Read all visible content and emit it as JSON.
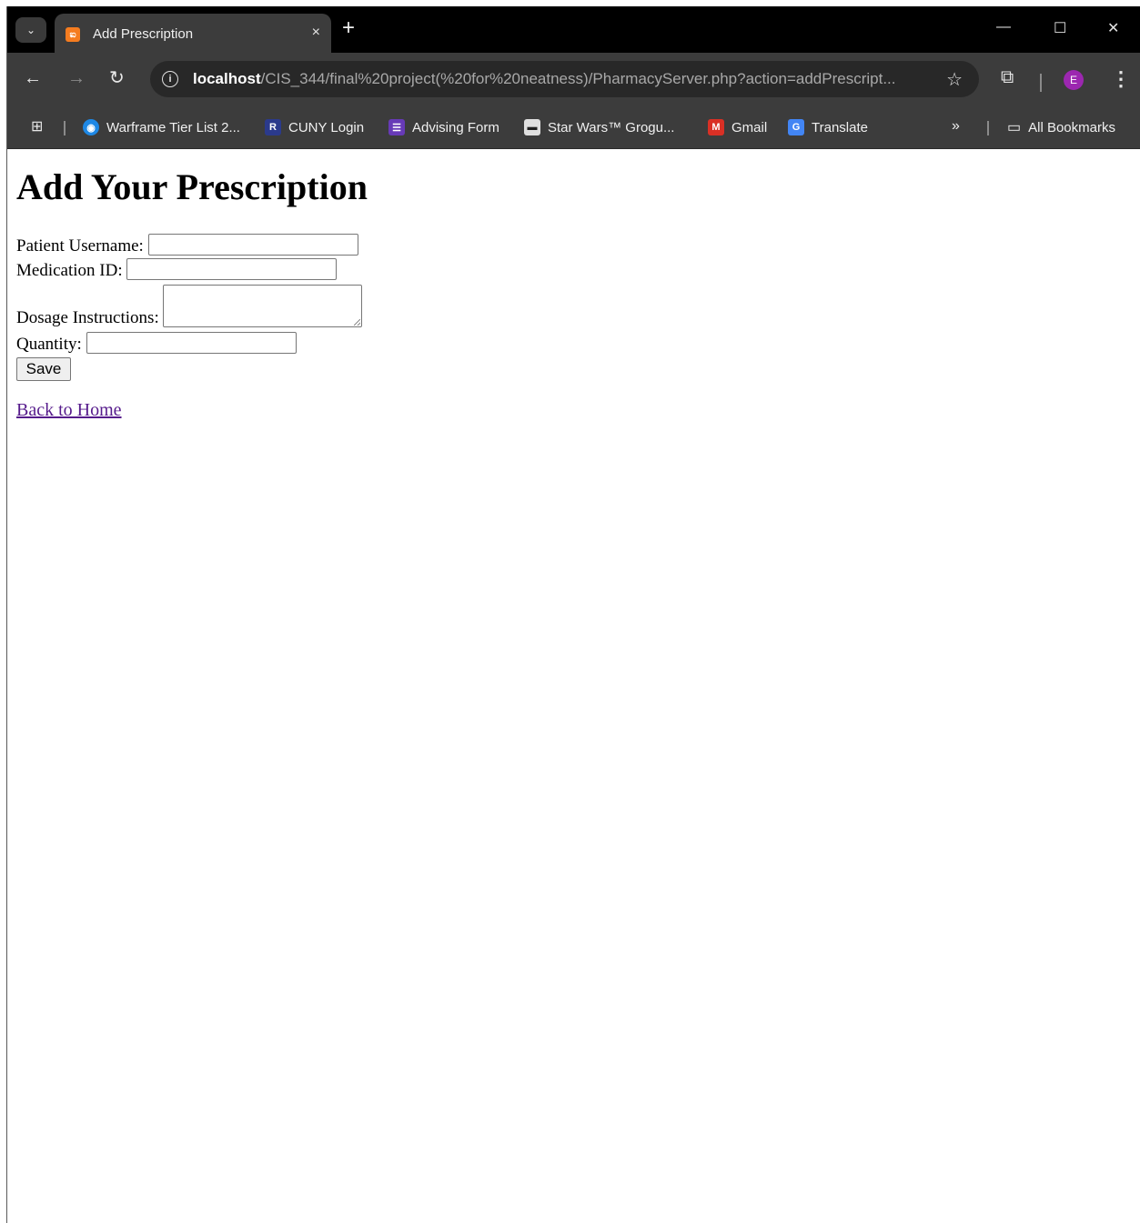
{
  "browser": {
    "tab": {
      "title": "Add Prescription",
      "close_glyph": "×"
    },
    "new_tab_glyph": "+",
    "window_controls": {
      "minimize": "—",
      "maximize": "☐",
      "close": "✕"
    },
    "url": {
      "host": "localhost",
      "path": "/CIS_344/final%20project(%20for%20neatness)/PharmacyServer.php?action=addPrescript..."
    },
    "profile_initial": "E",
    "bookmarks": [
      {
        "label": "Warframe Tier List 2...",
        "icon": "warframe-icon",
        "color": "#1e88e5"
      },
      {
        "label": "CUNY Login",
        "icon": "cuny-icon",
        "color": "#2b3a8c"
      },
      {
        "label": "Advising Form",
        "icon": "forms-icon",
        "color": "#673ab7"
      },
      {
        "label": "Star Wars™ Grogu...",
        "icon": "starwars-icon",
        "color": "#202020"
      },
      {
        "label": "Gmail",
        "icon": "gmail-icon",
        "color": "#d93025"
      },
      {
        "label": "Translate",
        "icon": "translate-icon",
        "color": "#4285f4"
      }
    ],
    "bookmarks_overflow": "»",
    "all_bookmarks": "All Bookmarks"
  },
  "page": {
    "heading": "Add Your Prescription",
    "form": {
      "patient_username_label": "Patient Username:",
      "medication_id_label": "Medication ID:",
      "dosage_instructions_label": "Dosage Instructions:",
      "quantity_label": "Quantity:",
      "save_label": "Save"
    },
    "back_link": "Back to Home"
  }
}
